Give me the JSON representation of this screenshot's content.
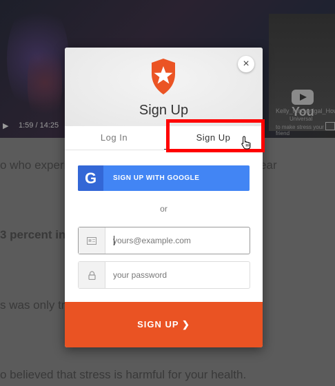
{
  "background": {
    "video_time": "1:59 / 14:25",
    "yt_brand": "You",
    "yt_sub_a": "Kelly_McGonigal_How",
    "yt_sub_b": "Universal",
    "yt_sub_c": "to make stress your friend",
    "article_lines": [
      {
        "text": "o who experienced a lot of stress in the previous year",
        "bold": false
      },
      {
        "text": "3 percent increased risk of dying",
        "bold": true
      },
      {
        "text": "s was only true for the people who also believed",
        "bold": false
      },
      {
        "text": "o believed that stress is harmful for your health.",
        "bold": false
      }
    ]
  },
  "modal": {
    "title": "Sign Up",
    "close_glyph": "×",
    "tabs": [
      {
        "label": "Log In",
        "active": false
      },
      {
        "label": "Sign Up",
        "active": true
      }
    ],
    "google_button": {
      "glyph": "G",
      "label": "SIGN UP WITH GOOGLE"
    },
    "divider_text": "or",
    "email_field": {
      "placeholder": "yours@example.com",
      "icon": "email-icon"
    },
    "password_field": {
      "placeholder": "your password",
      "icon": "lock-icon"
    },
    "submit_label": "SIGN UP ❯"
  },
  "colors": {
    "accent": "#ea5323",
    "google": "#4285f4",
    "highlight": "#ff0000"
  }
}
